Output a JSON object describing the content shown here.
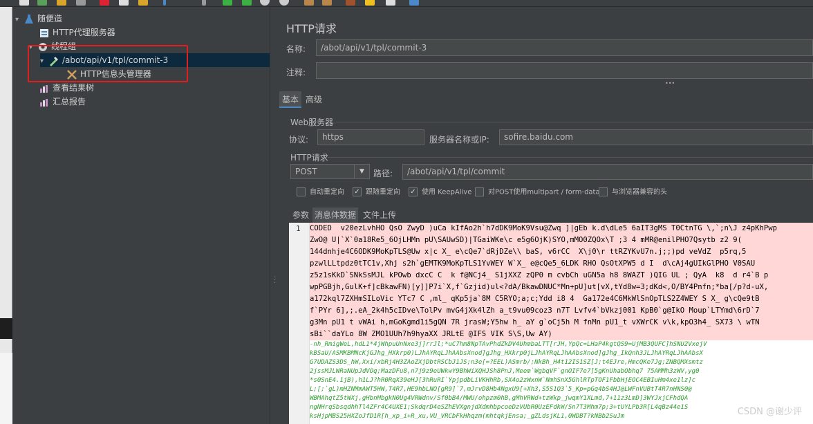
{
  "tree": {
    "root": "随便造",
    "proxy": "HTTP代理服务器",
    "thread_group": "线程组",
    "request": "/abot/api/v1/tpl/commit-3",
    "header_manager": "HTTP信息头管理器",
    "result_tree": "查看结果树",
    "summary": "汇总报告"
  },
  "panel": {
    "title": "HTTP请求",
    "name_label": "名称:",
    "name_value": "/abot/api/v1/tpl/commit-3",
    "comment_label": "注释:",
    "comment_value": "",
    "dots": "•••",
    "tab_basic": "基本",
    "tab_advanced": "高级",
    "web_server": "Web服务器",
    "protocol_label": "协议:",
    "protocol_value": "https",
    "server_label": "服务器名称或IP:",
    "server_value": "sofire.baidu.com",
    "http_request": "HTTP请求",
    "method": "POST",
    "path_label": "路径:",
    "path_value": "/abot/api/v1/tpl/commit",
    "cb_redirect": "自动重定向",
    "cb_follow": "跟随重定向",
    "cb_keepalive": "使用 KeepAlive",
    "cb_multipart": "对POST使用multipart / form-data",
    "cb_browser": "与浏览器兼容的头",
    "check_mark": "✓",
    "body_tab_params": "参数",
    "body_tab_body": "消息体数据",
    "body_tab_files": "文件上传",
    "line_number": "1"
  },
  "code_lines": [
    "CODED  v20ezLvhHO QsO ZwyD )uCa kIfAo2h`h7dDK9MoK9Vsu@Zwq ]|gEb k.d\\dLe5 6aIT3gMS T0CtnTG \\,`;n\\J z4pKhPwp",
    "ZwO@ U|`X`0a18Re5_6OjLHMn pU\\SAUwSD)|TGaiWKe\\c e5g6OjK)SYO,mMO0ZQOx\\T ;3 4 mMR@enilPHO7Qsytb z2 9(",
    "144dnhje4C6ODK9MoKpTLS@Uw x|c X_ e\\cQe7`dRjDZe\\\\ baS, v6rCC  X\\j0\\r ttRZYKvU7n.j;;)pd veVdZ  p5rq,5",
    "pzwlLLtpdz0tTC1v,Xhj s2h`gEMTK9MoKpTLS1YvWEY W`X_ e@cQe5_6LDK RHO QsOtXPW5 d I  d\\cAj4gUIkGlPHO V0SAU",
    "z5z1sKkD`SNkSsMJL kPOwb dxcC C  k f@NCj4_ S1jXXZ zQP0 m cvbCh uGN5a h8 8WAZT )QIG UL ; QyA  k8  d r4`B p",
    "wpPGBjh,GulK+f]cBkawFN)[y]]P7i`X,f`Gzjid)ul<?dA/BkawDNUC*Mn+pU]ut[vX,tYd8w=3;dKd<,O/BY4Pnfn;*ba[/p?d-uX,",
    "a172kql7ZXHmSILoVic YTc7 C ,ml_ qKp5ja`8M C5RYO;a;c;Ydd i8 4  Ga172e4C6MkWlSnOpTLS2Z4WEY S X_ g\\cQe9tB",
    "f`PYr 6],;.eA_2k4h5cIDve\\TolPv mvG4jXk4lZh a_t9vu09coz3 n7T Lvfv4`bVkzj001 KpB0`g@IkO Moup`LTYmd\\6rD`7",
    "g3Mn pU1 t vWAi h,mGoKgmd1i5gQN 7R jrasW;Y5hw h_ aY g`oCj5h M fnMn pU1_t vXWrCK v\\k,kpO3h4_ SX73 \\ wTN",
    "sBi``daYLo 8W ZMO1UUh7h9hyaXX JRLtE @IFS VIK S\\S,Uw AY)"
  ],
  "green_lines": [
    "-nh_RmigWeL,hdL1*4jWhpuUnNxe3j]rrJl;*uC7hm8NpTAvPhdZkDV4UhmbaLTT[rJH,YpQc=LHaP4kgtQS9=UjMB3QUFC]hSNU2VxejV",
    "kBSaU/ASMKBMNcKjGJhg_HXkrp0)LJhAYRqLJhAAbsXnod]gJhg_HXkrp0jLJhAYRqLJhAAbsXnod]gJhg_IkQnh3JLJhAYRqLJhAAbsX",
    "G7UDAZS3DS_hW,Xxi/xbRj4H3ZAoZXjDbtRSCbJ1JS;n3e[=?EEL)ASmrb/;NkBh_H4t12IS1SZ[J;t4EJre,HmcQKe7Jg;ZNBQMXsmtz",
    "2jssMJLWRaNUpJdVOq;MazDFu8,n7j9z9eUWkwY9BhWiXQHJSh8PnJ,Meem`WgbqVF`gnOIF7e7]5gKnUhabObhq7 75AMMh3zWV,yg0",
    "*s0SnE4.1jB),h1LJ?hR0RqX39eHJ[3hRuRI`YpjpdbLiVKHhRb,SX4o2zWxnW`NmhSnX5GhlRTpTOF1FbbHjEOC4EBIuHm4xe1lz]c",
    "L;[;`gL)mHZNMmAWT5HW,T4R7,HE9hbLNO[gR9]`7,mJrvD8Hb4NgxU9[+Xh3,S5S1Q3`5_Kp=pGq4bS4HJ@LWFnVUBtT4R7nHNS0@",
    "WBMAhqtZ5tWXj,gHbnMbgkN0Ug4VRWdnv/Sf0bB4/MWU/ohpzm0hB,gMhVRWd+tzWkp_jwqmY1XLmd,7+11z3LmD]3WYJxjCFhdQA",
    "ngNHrqSbsqdhhTl4ZFr4C4UXE1;SkdqrD4eSZhEVXgnjdXdmhbpcoeDzVUbR0UzEFdkW/Sn7T3Mhm7p;3+tUYLPb3R[L4qBz44e1S",
    "ksHjpMBS25HXZoJfD1R[h_xp_i+R_xu,VU_VRCbFkHhqzm(mhtqkjEnsa;_gZLdsjKL1,0WDBT?kNBb2SuJm"
  ],
  "watermark": "CSDN @谢少评"
}
